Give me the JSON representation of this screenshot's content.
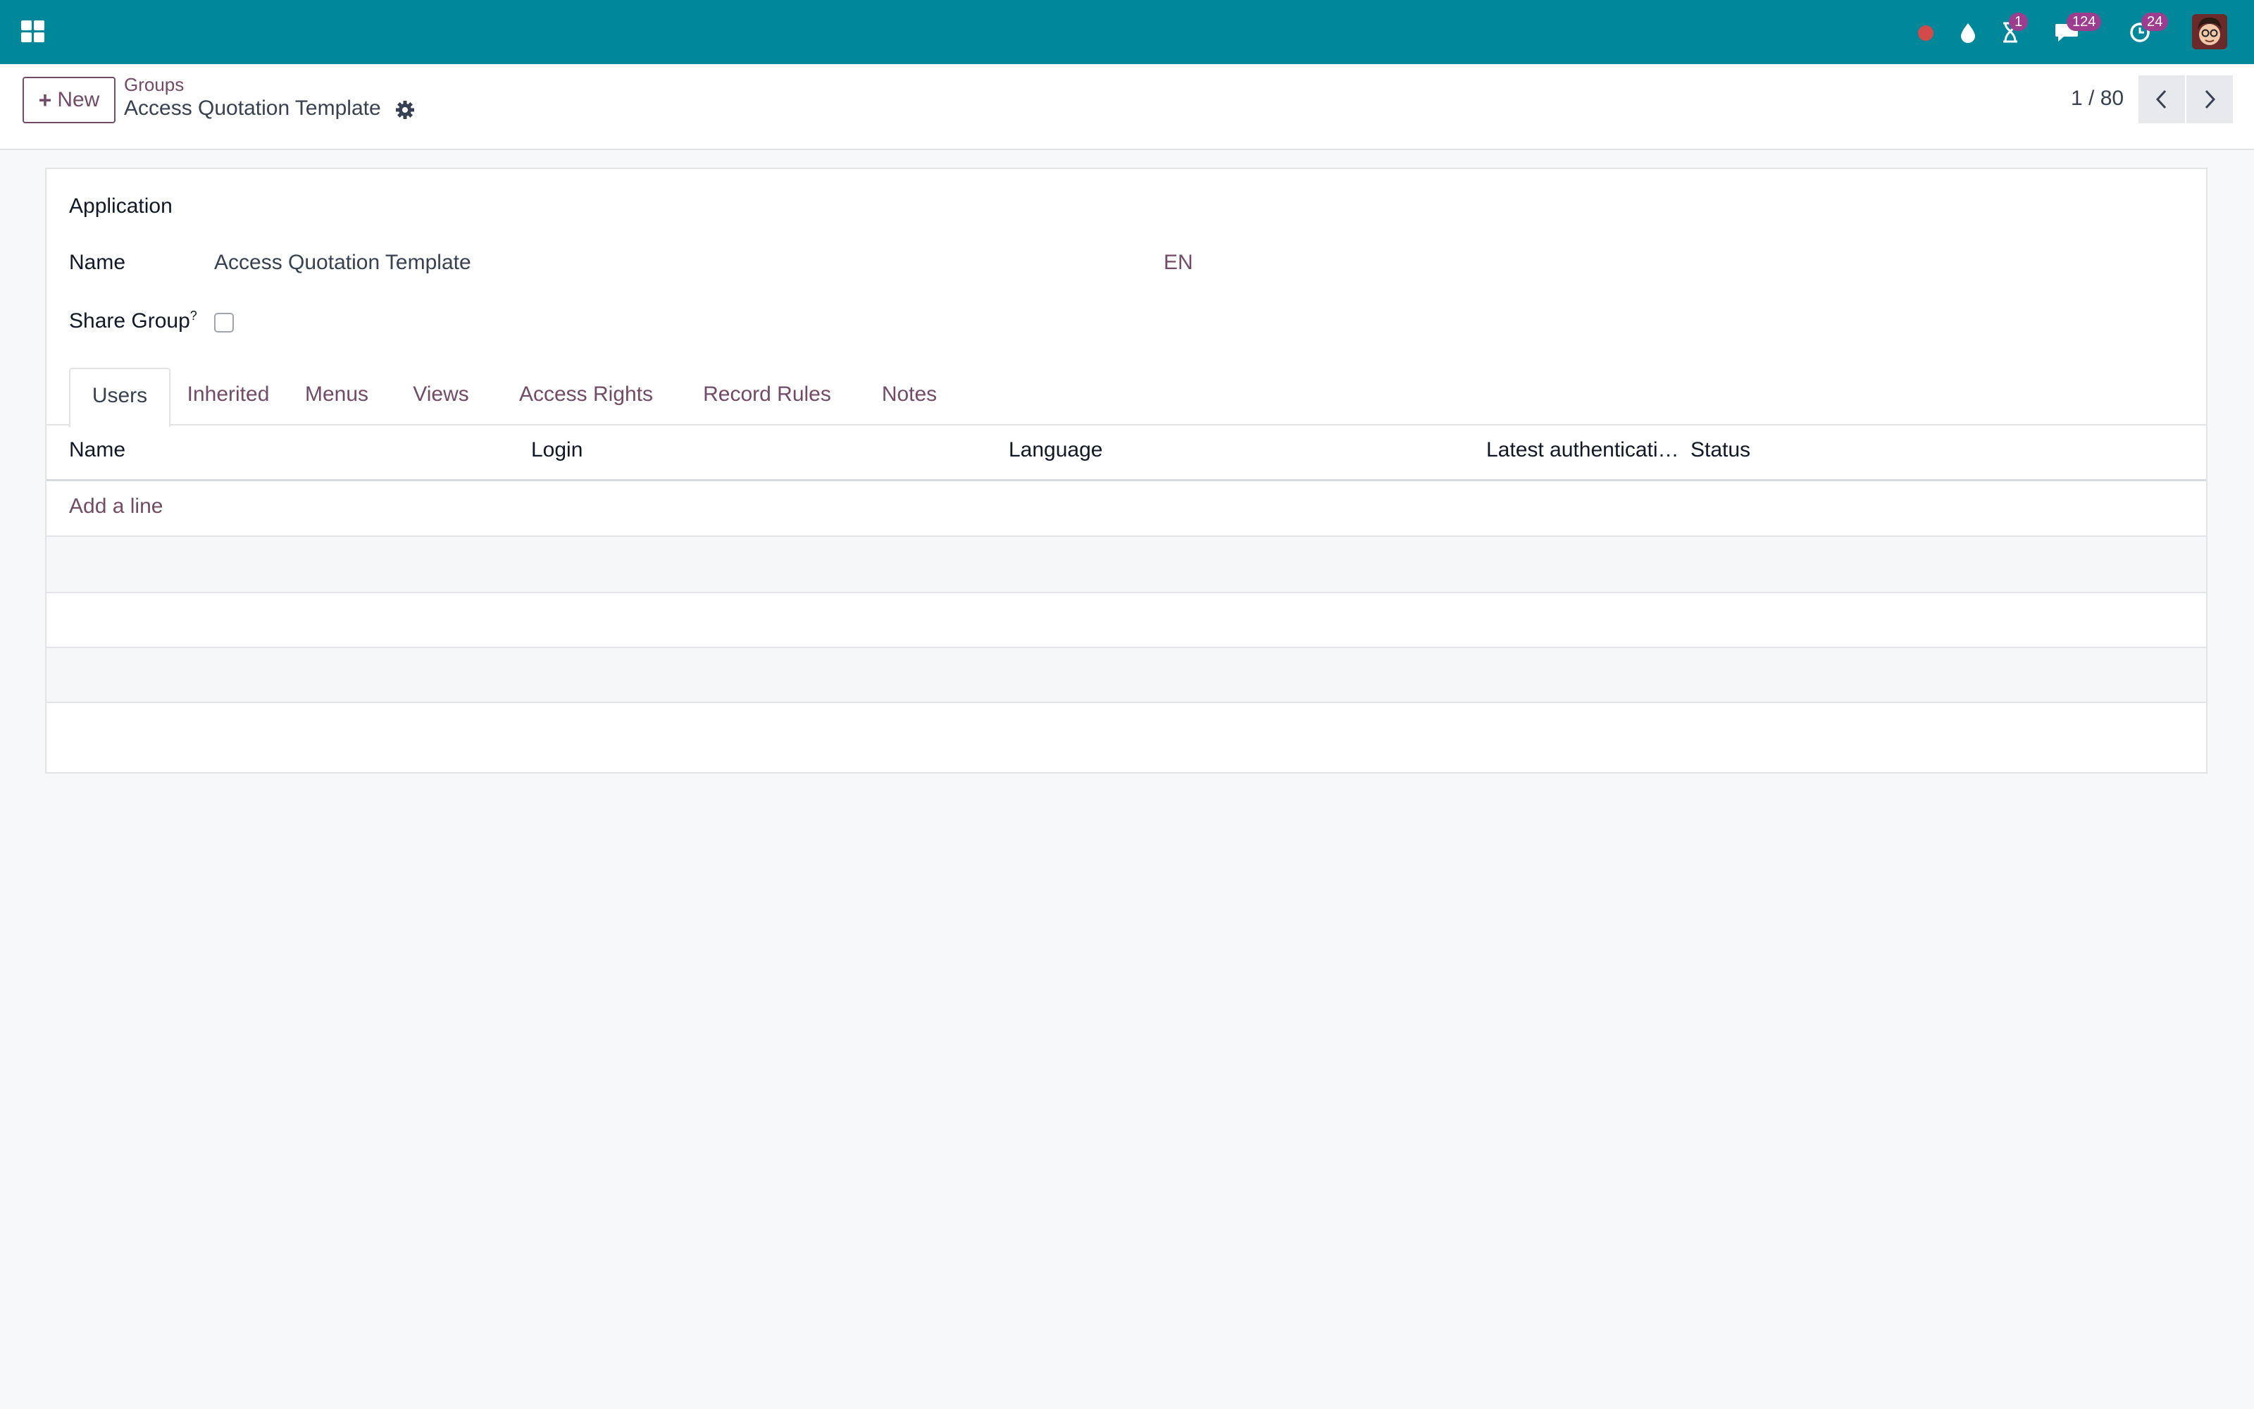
{
  "colors": {
    "topbar": "#00879a",
    "accent": "#714b67",
    "badge": "#9c3d8f",
    "record_dot": "#d24b4b"
  },
  "topbar": {
    "apps_icon": "apps-grid-icon",
    "systray": [
      {
        "icon": "record-dot-icon",
        "badge": ""
      },
      {
        "icon": "droplet-icon",
        "badge": ""
      },
      {
        "icon": "hourglass-icon",
        "badge": "1"
      },
      {
        "icon": "chat-bubble-icon",
        "badge": "124"
      },
      {
        "icon": "clock-activity-icon",
        "badge": "24"
      }
    ],
    "avatar": "user-avatar"
  },
  "control_panel": {
    "new_label": "New",
    "breadcrumb_parent": "Groups",
    "breadcrumb_current": "Access Quotation Template",
    "pager": "1 / 80"
  },
  "form": {
    "application_label": "Application",
    "name_label": "Name",
    "name_value": "Access Quotation Template",
    "lang_code": "EN",
    "share_group_label": "Share Group",
    "share_group_help": "?",
    "share_group_checked": false
  },
  "tabs": [
    "Users",
    "Inherited",
    "Menus",
    "Views",
    "Access Rights",
    "Record Rules",
    "Notes"
  ],
  "active_tab": "Users",
  "users_table": {
    "columns": [
      "Name",
      "Login",
      "Language",
      "Latest authenticati…",
      "Status"
    ],
    "add_line": "Add a line",
    "rows": []
  }
}
